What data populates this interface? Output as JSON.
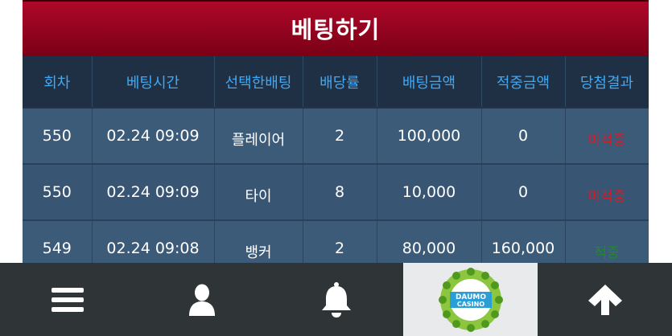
{
  "header": {
    "title": "베팅하기"
  },
  "table": {
    "columns": [
      "회차",
      "베팅시간",
      "선택한배팅",
      "배당률",
      "배팅금액",
      "적중금액",
      "당첨결과"
    ],
    "rows": [
      {
        "round": "550",
        "time": "02.24 09:09",
        "selection": "플레이어",
        "odds": "2",
        "amount": "100,000",
        "payout": "0",
        "result": "미적중"
      },
      {
        "round": "550",
        "time": "02.24 09:09",
        "selection": "타이",
        "odds": "8",
        "amount": "10,000",
        "payout": "0",
        "result": "미적중"
      },
      {
        "round": "549",
        "time": "02.24 09:08",
        "selection": "뱅커",
        "odds": "2",
        "amount": "80,000",
        "payout": "160,000",
        "result": "적중"
      }
    ]
  },
  "colors": {
    "accent": "#9a0a24",
    "header_text": "#3fa9f5",
    "lose": "#cc1f2a",
    "win": "#1f8a2d"
  },
  "bottom_nav": {
    "items": [
      {
        "icon": "menu-icon"
      },
      {
        "icon": "user-icon"
      },
      {
        "icon": "bell-icon"
      },
      {
        "icon": "casino-logo",
        "logo_text_1": "DAUMO",
        "logo_text_2": "CASINO"
      },
      {
        "icon": "arrow-up-icon"
      }
    ]
  }
}
